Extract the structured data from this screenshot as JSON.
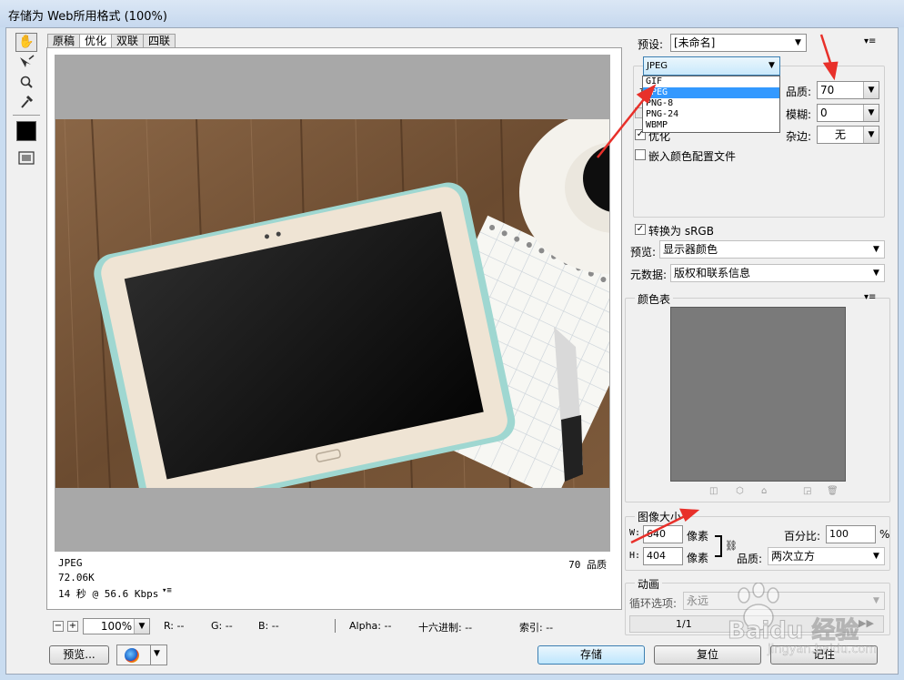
{
  "window": {
    "title": "存储为 Web所用格式 (100%)"
  },
  "tabs": [
    "原稿",
    "优化",
    "双联",
    "四联"
  ],
  "tools": [
    "hand-icon",
    "slice-select-icon",
    "zoom-icon",
    "eyedropper-icon",
    "eyedropper-color-swatch",
    "toggle-slices-icon"
  ],
  "image_info": {
    "format": "JPEG",
    "size": "72.06K",
    "time": "14 秒 @ 56.6 Kbps",
    "quality_label": "70 品质"
  },
  "status": {
    "zoom": "100%",
    "r": "R: --",
    "g": "G: --",
    "b": "B: --",
    "alpha": "Alpha: --",
    "hex": "十六进制: --",
    "index": "索引: --"
  },
  "bottom_buttons": {
    "preview": "预览...",
    "save": "存储",
    "reset": "复位",
    "remember": "记住"
  },
  "settings": {
    "preset_label": "预设:",
    "preset_value": "[未命名]",
    "format_value": "JPEG",
    "format_options": [
      "GIF",
      "JPEG",
      "PNG-8",
      "PNG-24",
      "WBMP"
    ],
    "selected_format_index": 1,
    "quality_label": "品质:",
    "quality_value": "70",
    "blur_label": "模糊:",
    "blur_value": "0",
    "matte_label": "杂边:",
    "matte_value": "无",
    "optimize_label": "优化",
    "optimize_checked": true,
    "embed_profile_label": "嵌入颜色配置文件",
    "embed_profile_checked": false,
    "convert_srgb_label": "转换为 sRGB",
    "convert_srgb_checked": true,
    "preview_label": "预览:",
    "preview_value": "显示器颜色",
    "metadata_label": "元数据:",
    "metadata_value": "版权和联系信息"
  },
  "color_table": {
    "title": "颜色表"
  },
  "image_size": {
    "title": "图像大小",
    "w_label": "W:",
    "w_value": "640",
    "h_label": "H:",
    "h_value": "404",
    "unit": "像素",
    "percent_label": "百分比:",
    "percent_value": "100",
    "percent_unit": "%",
    "quality_label": "品质:",
    "quality_value": "两次立方"
  },
  "animation": {
    "title": "动画",
    "loop_label": "循环选项:",
    "loop_value": "永远",
    "frame_counter": "1/1"
  },
  "watermark": {
    "brand": "Baidu 经验",
    "url": "jingyan.baidu.com"
  },
  "colors": {
    "annotation": "#e8302a",
    "selection": "#3399ff",
    "canvas": "#a8a8a8"
  }
}
